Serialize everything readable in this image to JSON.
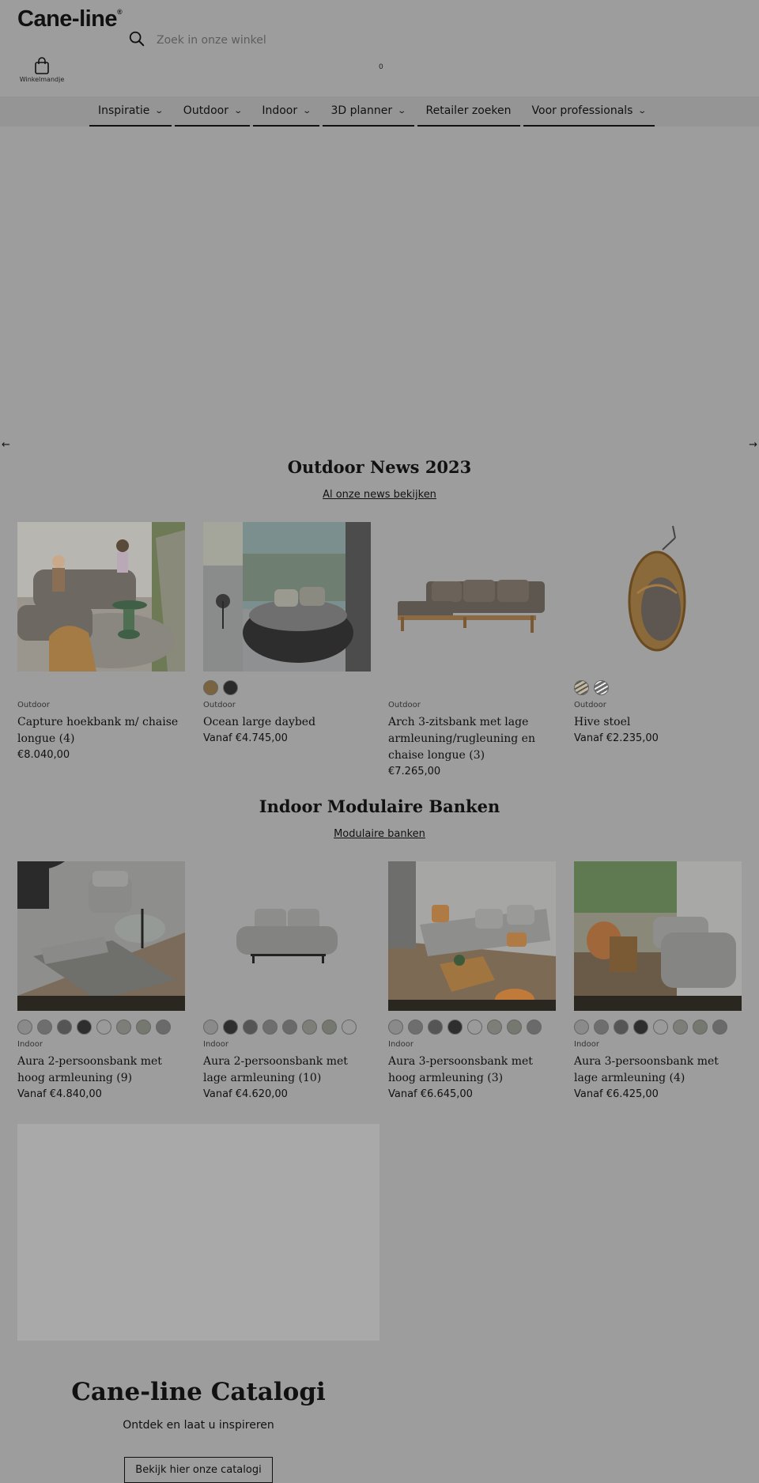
{
  "header": {
    "logo": "Cane-line",
    "logo_mark": "®",
    "search_placeholder": "Zoek in onze winkel",
    "cart_label": "Winkelmandje",
    "cart_count": "0"
  },
  "nav": {
    "items": [
      {
        "label": "Inspiratie",
        "has_dropdown": true
      },
      {
        "label": "Outdoor",
        "has_dropdown": true
      },
      {
        "label": "Indoor",
        "has_dropdown": true
      },
      {
        "label": "3D planner",
        "has_dropdown": true
      },
      {
        "label": "Retailer zoeken",
        "has_dropdown": false
      },
      {
        "label": "Voor professionals",
        "has_dropdown": true
      }
    ]
  },
  "carousel": {
    "prev_icon": "arrow-left-icon",
    "next_icon": "arrow-right-icon"
  },
  "outdoor_section": {
    "title": "Outdoor News 2023",
    "link": "Al onze news bekijken",
    "products": [
      {
        "category": "Outdoor",
        "name": "Capture hoekbank m/ chaise longue (4)",
        "price": "€8.040,00",
        "swatches": []
      },
      {
        "category": "Outdoor",
        "name": "Ocean large daybed",
        "price": "Vanaf €4.745,00",
        "swatches": [
          "#7a6440",
          "#2a2a2a"
        ]
      },
      {
        "category": "Outdoor",
        "name": "Arch 3-zitsbank met lage armleuning/rugleuning en chaise longue (3)",
        "price": "€7.265,00",
        "swatches": []
      },
      {
        "category": "Outdoor",
        "name": "Hive stoel",
        "price": "Vanaf €2.235,00",
        "swatches": [
          "#b5a98f",
          "#4a4a4a"
        ]
      }
    ]
  },
  "indoor_section": {
    "title": "Indoor Modulaire Banken",
    "link": "Modulaire banken",
    "products": [
      {
        "category": "Indoor",
        "name": "Aura 2-persoonsbank met hoog armleuning (9)",
        "price": "Vanaf €4.840,00",
        "swatches": [
          "#8a8a8a",
          "#6e6e6e",
          "#555555",
          "#2e2e2e",
          "#9a9a9a",
          "#7e7e78",
          "#75786e",
          "#6a6a6a"
        ]
      },
      {
        "category": "Indoor",
        "name": "Aura 2-persoonsbank met lage armleuning (10)",
        "price": "Vanaf €4.620,00",
        "swatches": [
          "#8a8a8a",
          "#2e2e2e",
          "#555555",
          "#6e6e6e",
          "#6a6a6a",
          "#7e7e78",
          "#75786e",
          "#9a9a9a"
        ]
      },
      {
        "category": "Indoor",
        "name": "Aura 3-persoonsbank met hoog armleuning (3)",
        "price": "Vanaf €6.645,00",
        "swatches": [
          "#8a8a8a",
          "#6e6e6e",
          "#555555",
          "#2e2e2e",
          "#9a9a9a",
          "#7e7e78",
          "#75786e",
          "#6a6a6a"
        ]
      },
      {
        "category": "Indoor",
        "name": "Aura 3-persoonsbank met lage armleuning (4)",
        "price": "Vanaf €6.425,00",
        "swatches": [
          "#8a8a8a",
          "#6e6e6e",
          "#555555",
          "#2e2e2e",
          "#9a9a9a",
          "#7e7e78",
          "#75786e",
          "#6a6a6a"
        ]
      }
    ]
  },
  "catalog": {
    "title": "Cane-line Catalogi",
    "subtitle": "Ontdek en laat u inspireren",
    "button": "Bekijk hier onze catalogi"
  }
}
